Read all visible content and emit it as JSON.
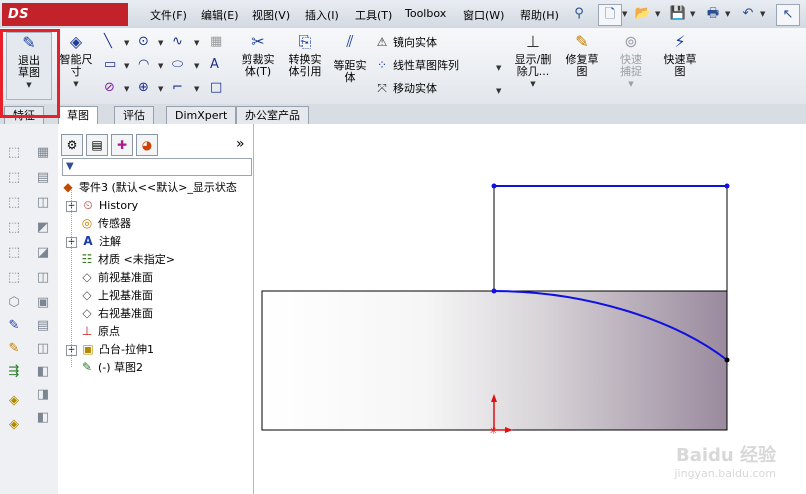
{
  "app": {
    "logo_text": "DS SOLIDWORKS"
  },
  "menu": {
    "items": [
      "文件(F)",
      "编辑(E)",
      "视图(V)",
      "插入(I)",
      "工具(T)",
      "Toolbox",
      "窗口(W)",
      "帮助(H)"
    ]
  },
  "ribbon": {
    "exit_sketch": "退出草图",
    "smart_dim": "智能尺寸",
    "trim": "剪裁实体(T)",
    "convert": "转换实体引用",
    "offset": "等距实体",
    "mirror": "镜向实体",
    "linear_pattern": "线性草图阵列",
    "move": "移动实体",
    "show_delete": "显示/删除几...",
    "repair": "修复草图",
    "quick_snap": "快速捕捉",
    "rapid_sketch": "快速草图"
  },
  "tabs": [
    "特征",
    "草图",
    "评估",
    "DimXpert",
    "办公室产品"
  ],
  "tree": {
    "root": "零件3 (默认<<默认>_显示状态",
    "items": [
      {
        "label": "History",
        "icon": "history-icon",
        "expand": true
      },
      {
        "label": "传感器",
        "icon": "sensor-icon",
        "expand": false
      },
      {
        "label": "注解",
        "icon": "annotation-icon",
        "expand": true
      },
      {
        "label": "材质 <未指定>",
        "icon": "material-icon",
        "expand": false
      },
      {
        "label": "前视基准面",
        "icon": "plane-icon",
        "expand": false
      },
      {
        "label": "上视基准面",
        "icon": "plane-icon",
        "expand": false
      },
      {
        "label": "右视基准面",
        "icon": "plane-icon",
        "expand": false
      },
      {
        "label": "原点",
        "icon": "origin-icon",
        "expand": false
      },
      {
        "label": "凸台-拉伸1",
        "icon": "boss-extrude-icon",
        "expand": true
      },
      {
        "label": "(-) 草图2",
        "icon": "sketch-icon",
        "expand": false
      }
    ]
  },
  "watermark": {
    "line1": "Baidu 经验",
    "line2": "jingyan.baidu.com"
  }
}
